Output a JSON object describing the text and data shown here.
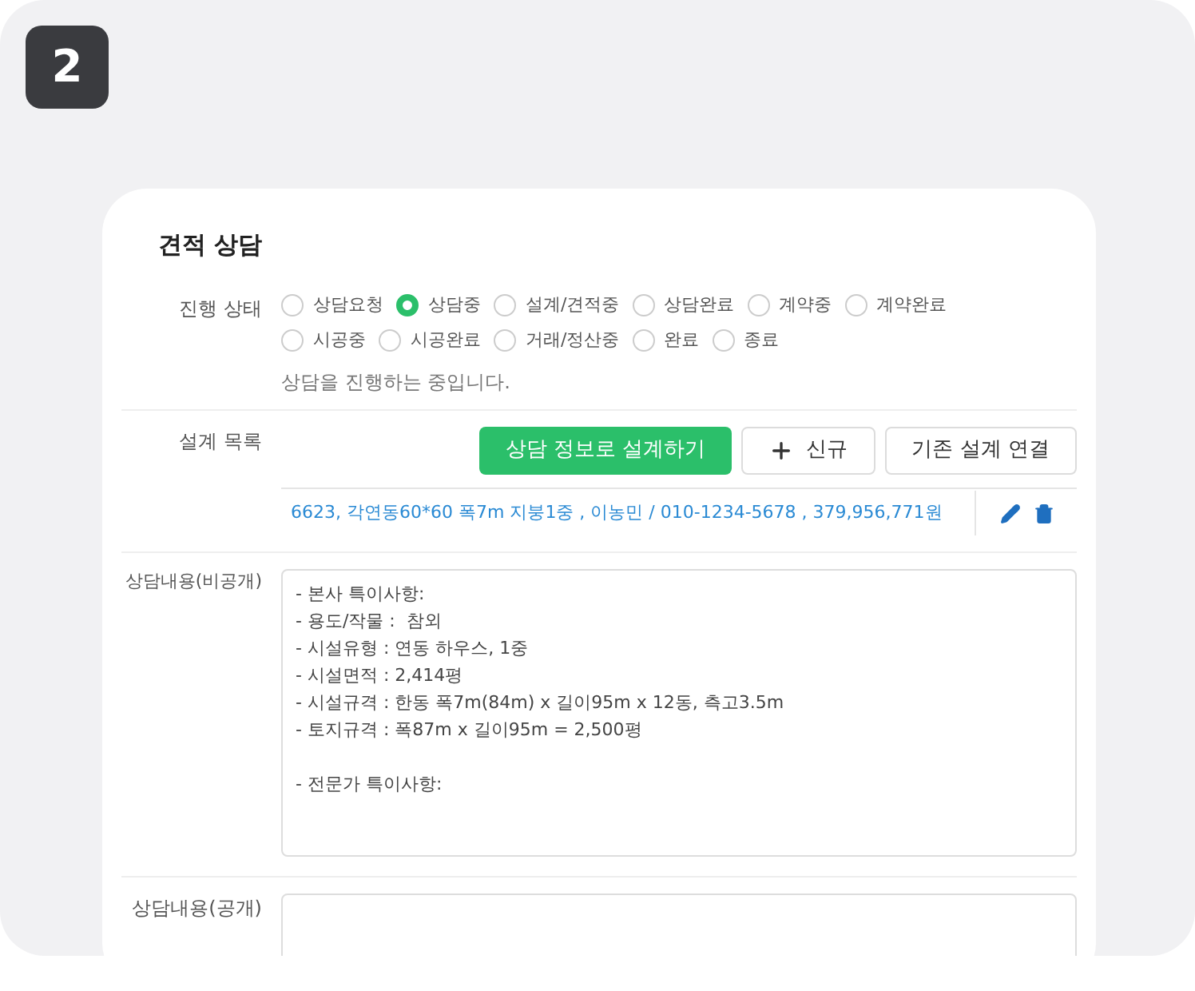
{
  "step_badge": "2",
  "card": {
    "title": "견적 상담",
    "status": {
      "label": "진행 상태",
      "options": [
        {
          "label": "상담요청",
          "selected": false
        },
        {
          "label": "상담중",
          "selected": true
        },
        {
          "label": "설계/견적중",
          "selected": false
        },
        {
          "label": "상담완료",
          "selected": false
        },
        {
          "label": "계약중",
          "selected": false
        },
        {
          "label": "계약완료",
          "selected": false
        },
        {
          "label": "시공중",
          "selected": false
        },
        {
          "label": "시공완료",
          "selected": false
        },
        {
          "label": "거래/정산중",
          "selected": false
        },
        {
          "label": "완료",
          "selected": false
        },
        {
          "label": "종료",
          "selected": false
        }
      ],
      "hint": "상담을 진행하는 중입니다."
    },
    "designs": {
      "label": "설계 목록",
      "buttons": [
        {
          "kind": "primary",
          "label": "상담 정보로 설계하기"
        },
        {
          "kind": "add",
          "label": "신규"
        },
        {
          "kind": "plain",
          "label": "기존 설계 연결"
        }
      ],
      "items": [
        "6623, 각연동60*60 폭7m 지붕1중 , 이농민 / 010-1234-5678 , 379,956,771원"
      ]
    },
    "private_notes": {
      "label": "상담내용(비공개)",
      "paragraphs": [
        [
          "- 본사 특이사항:",
          "- 용도/작물 :  참외",
          "- 시설유형 : 연동 하우스, 1중",
          "- 시설면적 : 2,414평",
          "- 시설규격 : 한동 폭7m(84m) x 길이95m x 12동, 측고3.5m",
          "- 토지규격 : 폭87m x 길이95m = 2,500평"
        ],
        [
          "- 전문가 특이사항:"
        ]
      ]
    },
    "public_notes": {
      "label": "상담내용(공개)"
    }
  }
}
